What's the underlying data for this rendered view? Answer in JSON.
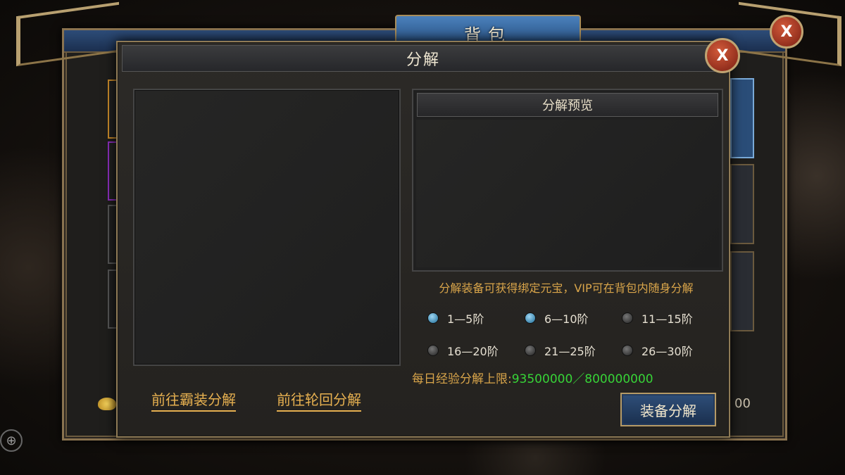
{
  "outer": {
    "title": "背包",
    "close_label": "X",
    "right_number_fragment": "00",
    "gold_icon": "gold-ingot-icon"
  },
  "dialog": {
    "title": "分解",
    "close_label": "X",
    "preview_title": "分解预览",
    "info_text": "分解装备可获得绑定元宝，VIP可在背包内随身分解",
    "ranks": [
      {
        "label": "1—5阶",
        "selected": true
      },
      {
        "label": "6—10阶",
        "selected": true
      },
      {
        "label": "11—15阶",
        "selected": false
      },
      {
        "label": "16—20阶",
        "selected": false
      },
      {
        "label": "21—25阶",
        "selected": false
      },
      {
        "label": "26—30阶",
        "selected": false
      }
    ],
    "limit_label": "每日经验分解上限:",
    "limit_value": "93500000／800000000",
    "link_bazhuang": "前往霸装分解",
    "link_lunhui": "前往轮回分解",
    "decompose_button": "装备分解"
  },
  "colors": {
    "gold_text": "#d9a54a",
    "green_value": "#37d437",
    "button_blue": "#2f4f7a",
    "close_red": "#b83a22"
  }
}
